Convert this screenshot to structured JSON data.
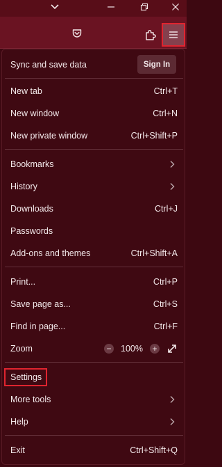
{
  "toolbar": {
    "pocket_icon": "pocket-icon",
    "extensions_icon": "puzzle-icon",
    "menu_icon": "hamburger-icon"
  },
  "sync": {
    "label": "Sync and save data",
    "signin_label": "Sign In"
  },
  "menu": {
    "new_tab": {
      "label": "New tab",
      "shortcut": "Ctrl+T"
    },
    "new_window": {
      "label": "New window",
      "shortcut": "Ctrl+N"
    },
    "new_private_window": {
      "label": "New private window",
      "shortcut": "Ctrl+Shift+P"
    },
    "bookmarks": {
      "label": "Bookmarks"
    },
    "history": {
      "label": "History"
    },
    "downloads": {
      "label": "Downloads",
      "shortcut": "Ctrl+J"
    },
    "passwords": {
      "label": "Passwords"
    },
    "addons": {
      "label": "Add-ons and themes",
      "shortcut": "Ctrl+Shift+A"
    },
    "print": {
      "label": "Print...",
      "shortcut": "Ctrl+P"
    },
    "save_page": {
      "label": "Save page as...",
      "shortcut": "Ctrl+S"
    },
    "find": {
      "label": "Find in page...",
      "shortcut": "Ctrl+F"
    },
    "zoom": {
      "label": "Zoom",
      "minus": "−",
      "value": "100%",
      "plus": "+"
    },
    "settings": {
      "label": "Settings"
    },
    "more_tools": {
      "label": "More tools"
    },
    "help": {
      "label": "Help"
    },
    "exit": {
      "label": "Exit",
      "shortcut": "Ctrl+Shift+Q"
    }
  },
  "colors": {
    "titlebar": "#580d18",
    "toolbar": "#6a1322",
    "panel": "#3f0912",
    "highlight": "#e0242f"
  }
}
